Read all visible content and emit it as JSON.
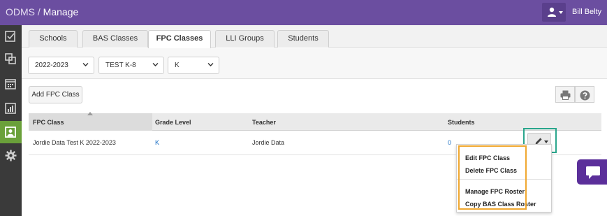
{
  "header": {
    "app": "ODMS",
    "separator": " / ",
    "page": "Manage",
    "user_name": "Bill Belty",
    "user_icon": "user-icon"
  },
  "sidebar": {
    "items": [
      {
        "icon": "checklist-icon"
      },
      {
        "icon": "copy-icon"
      },
      {
        "icon": "calendar-icon"
      },
      {
        "icon": "bar-chart-icon"
      },
      {
        "icon": "roster-icon",
        "active": true
      },
      {
        "icon": "gear-icon"
      }
    ],
    "active_color": "#6aa03a"
  },
  "tabs": {
    "items": [
      "Schools",
      "BAS Classes",
      "FPC Classes",
      "LLI Groups",
      "Students"
    ],
    "active": "FPC Classes"
  },
  "filters": {
    "year": "2022-2023",
    "school": "TEST K-8",
    "grade": "K"
  },
  "toolbar": {
    "add_label": "Add FPC Class",
    "print_icon": "print-icon",
    "help_icon": "help-icon"
  },
  "table": {
    "columns": [
      "FPC Class",
      "Grade Level",
      "Teacher",
      "Students"
    ],
    "sorted_column": "FPC Class",
    "rows": [
      {
        "fpc_class": "Jordie Data Test K 2022-2023",
        "grade_level": "K",
        "teacher": "Jordie Data",
        "students": "0"
      }
    ]
  },
  "actions_menu": {
    "button_icon": "pencil-icon",
    "items": [
      "Edit FPC Class",
      "Delete FPC Class",
      "Manage FPC Roster",
      "Copy BAS Class Roster"
    ]
  },
  "colors": {
    "topbar": "#6b4ea0",
    "sidebar": "#3a3a3a",
    "highlight_teal": "#2aa68c",
    "highlight_orange": "#f0a830",
    "link": "#1a6fc4",
    "chat": "#5b2f9a"
  }
}
